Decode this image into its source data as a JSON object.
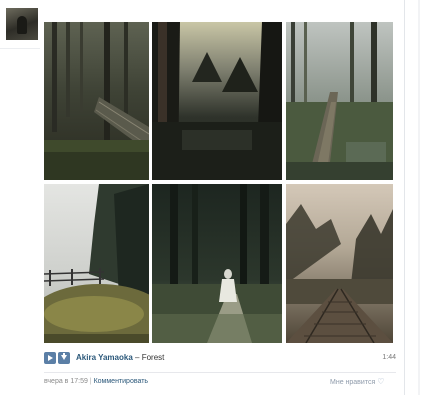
{
  "post": {
    "photos": [
      {
        "name": "forest-bridge-photo"
      },
      {
        "name": "dark-forest-photo"
      },
      {
        "name": "forest-boardwalk-photo"
      },
      {
        "name": "foggy-meadow-fence-photo"
      },
      {
        "name": "ghost-girl-forest-photo"
      },
      {
        "name": "misty-railway-photo"
      }
    ],
    "audio": {
      "artist": "Akira Yamaoka",
      "separator": " – ",
      "title": "Forest",
      "duration": "1:44"
    },
    "footer": {
      "time": "вчера в 17:59",
      "bar": " | ",
      "comment_link": "Комментировать",
      "like_label": "Мне нравится",
      "like_icon": "♡"
    },
    "colors": {
      "link": "#2b587a",
      "audio_button": "#5b7fa6"
    }
  }
}
